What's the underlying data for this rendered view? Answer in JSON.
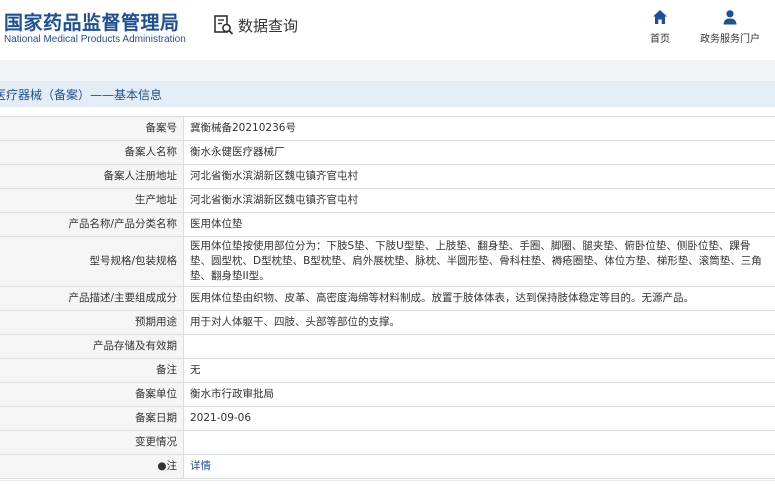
{
  "header": {
    "logo_cn": "国家药品监督管理局",
    "logo_en": "National Medical Products Administration",
    "query_label": "数据查询",
    "nav": [
      {
        "icon": "home-icon",
        "label": "首页"
      },
      {
        "icon": "user-icon",
        "label": "政务服务门户"
      }
    ]
  },
  "section_title": "医疗器械（备案）——基本信息",
  "rows": [
    {
      "label": "备案号",
      "value": "冀衡械备20210236号"
    },
    {
      "label": "备案人名称",
      "value": "衡水永健医疗器械厂"
    },
    {
      "label": "备案人注册地址",
      "value": "河北省衡水滨湖新区魏屯镇齐官屯村"
    },
    {
      "label": "生产地址",
      "value": "河北省衡水滨湖新区魏屯镇齐官屯村"
    },
    {
      "label": "产品名称/产品分类名称",
      "value": "医用体位垫"
    },
    {
      "label": "型号规格/包装规格",
      "value": "医用体位垫按使用部位分为：下肢S垫、下肢U型垫、上肢垫、翻身垫、手圈、脚圈、腿夹垫、俯卧位垫、侧卧位垫、踝骨垫、圆型枕、D型枕垫、B型枕垫、肩外展枕垫、脉枕、半圆形垫、骨科柱垫、褥疮圈垫、体位方垫、梯形垫、滚筒垫、三角垫、翻身垫II型。"
    },
    {
      "label": "产品描述/主要组成成分",
      "value": "医用体位垫由织物、皮革、高密度海绵等材料制成。放置于肢体体表，达到保持肢体稳定等目的。无源产品。"
    },
    {
      "label": "预期用途",
      "value": "用于对人体躯干、四肢、头部等部位的支撑。"
    },
    {
      "label": "产品存储及有效期",
      "value": ""
    },
    {
      "label": "备注",
      "value": "无"
    },
    {
      "label": "备案单位",
      "value": "衡水市行政审批局"
    },
    {
      "label": "备案日期",
      "value": "2021-09-06"
    },
    {
      "label": "变更情况",
      "value": ""
    },
    {
      "label": "●注",
      "value": "详情"
    }
  ],
  "colors": {
    "brand": "#1f4f95",
    "bar_bg": "#e4edf6",
    "label_bg": "#f5f5f5",
    "border": "#d8dde4"
  }
}
